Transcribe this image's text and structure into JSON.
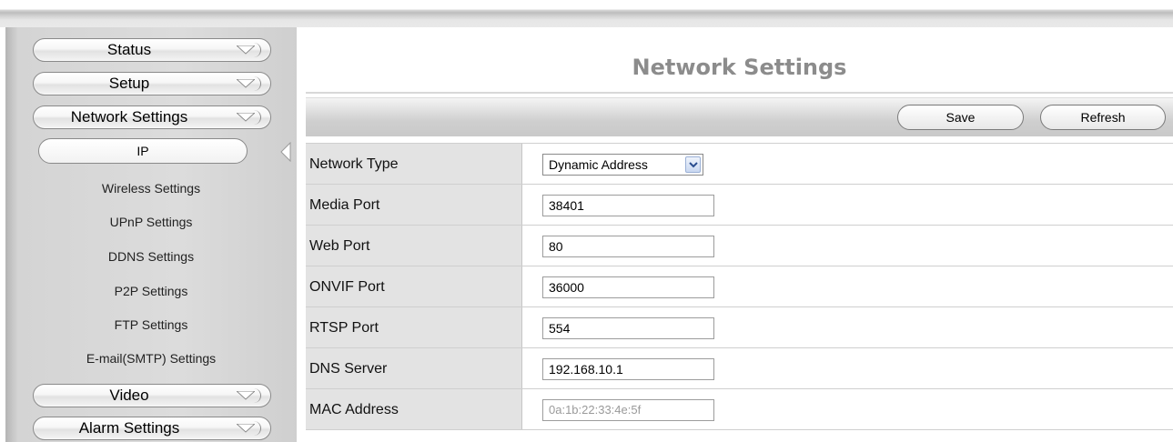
{
  "sidebar": {
    "menu_top": [
      {
        "label": "Status"
      },
      {
        "label": "Setup"
      },
      {
        "label": "Network Settings"
      }
    ],
    "sub_active": "IP",
    "sub_items": [
      "Wireless Settings",
      "UPnP Settings",
      "DDNS Settings",
      "P2P Settings",
      "FTP Settings",
      "E-mail(SMTP) Settings"
    ],
    "menu_bottom": [
      {
        "label": "Video"
      },
      {
        "label": "Alarm Settings"
      }
    ]
  },
  "page": {
    "title": "Network Settings"
  },
  "toolbar": {
    "save_label": "Save",
    "refresh_label": "Refresh"
  },
  "form": {
    "network_type": {
      "label": "Network Type",
      "value": "Dynamic Address"
    },
    "media_port": {
      "label": "Media Port",
      "value": "38401"
    },
    "web_port": {
      "label": "Web Port",
      "value": "80"
    },
    "onvif_port": {
      "label": "ONVIF Port",
      "value": "36000"
    },
    "rtsp_port": {
      "label": "RTSP Port",
      "value": "554"
    },
    "dns_server": {
      "label": "DNS Server",
      "value": "192.168.10.1"
    },
    "mac_address": {
      "label": "MAC Address",
      "value": "0a:1b:22:33:4e:5f"
    }
  },
  "icons": {
    "menu_expand": "triangle-down-icon",
    "active_pointer": "triangle-left-icon",
    "select_arrow": "chevron-down-icon"
  }
}
